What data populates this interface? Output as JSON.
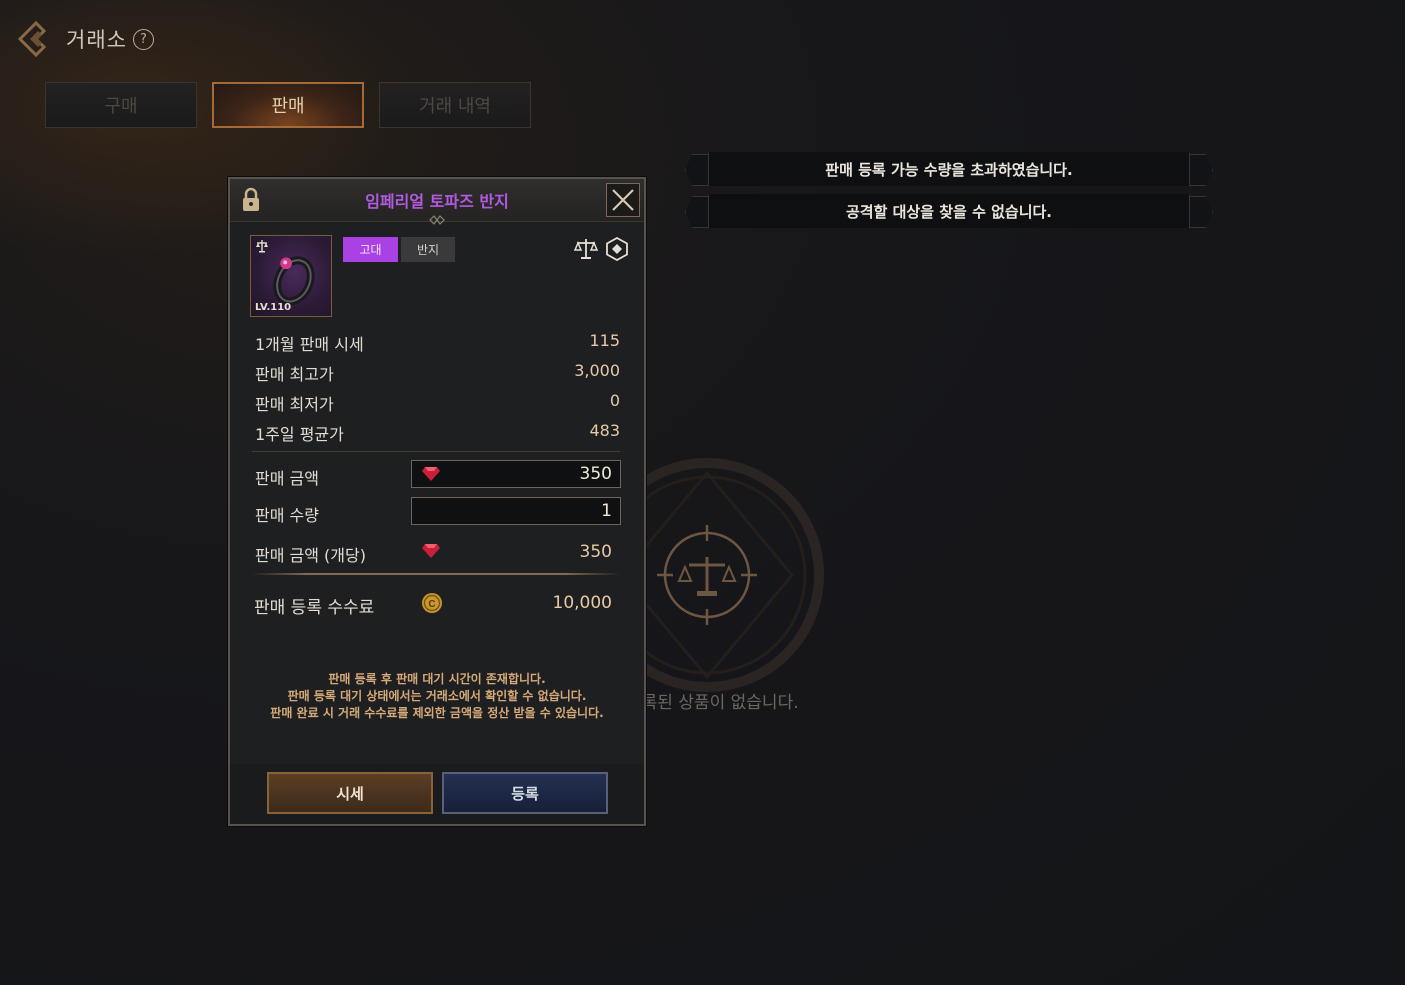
{
  "header": {
    "title": "거래소",
    "help_icon": "?"
  },
  "tabs": [
    {
      "label": "구매",
      "active": false
    },
    {
      "label": "판매",
      "active": true
    },
    {
      "label": "거래 내역",
      "active": false
    }
  ],
  "notifications": [
    "판매 등록 가능 수량을 초과하였습니다.",
    "공격할 대상을 찾을 수 없습니다."
  ],
  "empty_state": {
    "text": "등록된 상품이 없습니다."
  },
  "modal": {
    "title": "임페리얼 토파즈 반지",
    "item": {
      "level": "LV.110",
      "grade": "고대",
      "type": "반지",
      "icon": "ring-icon"
    },
    "stats": [
      {
        "label": "1개월 판매 시세",
        "value": "115"
      },
      {
        "label": "판매 최고가",
        "value": "3,000"
      },
      {
        "label": "판매 최저가",
        "value": "0"
      },
      {
        "label": "1주일 평균가",
        "value": "483"
      }
    ],
    "price": {
      "label": "판매 금액",
      "value": "350",
      "currency_icon": "red-gem-icon"
    },
    "quantity": {
      "label": "판매 수량",
      "value": "1"
    },
    "unit_price": {
      "label": "판매 금액 (개당)",
      "value": "350",
      "currency_icon": "red-gem-icon"
    },
    "fee": {
      "label": "판매 등록 수수료",
      "value": "10,000",
      "currency_icon": "gold-coin-icon"
    },
    "notes": [
      "판매 등록 후 판매 대기 시간이 존재합니다.",
      "판매 등록 대기 상태에서는 거래소에서 확인할 수 없습니다.",
      "판매 완료 시 거래 수수료를 제외한 금액을 정산 받을 수 있습니다."
    ],
    "buttons": {
      "price_history": "시세",
      "register": "등록"
    }
  },
  "colors": {
    "grade_ancient": "#a941e4",
    "title_purple": "#b25ae0",
    "value_gold": "#e8c9a8",
    "notes_orange": "#d6a978"
  }
}
